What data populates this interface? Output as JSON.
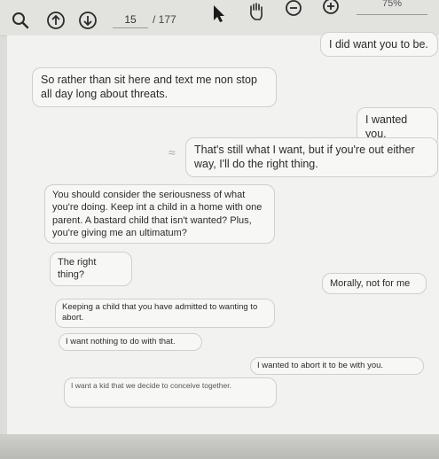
{
  "toolbar": {
    "page_current": "15",
    "page_total": "/ 177",
    "zoom": "75%"
  },
  "messages": [
    {
      "side": "right",
      "text": "I did want you to be."
    },
    {
      "side": "left",
      "text": "So rather than sit here and text me non stop all day long about threats."
    },
    {
      "side": "right",
      "text": "I wanted you."
    },
    {
      "side": "right",
      "text": "That's still what I want, but if you're out either way, I'll do the right thing."
    },
    {
      "side": "left",
      "text": "You should consider the seriousness of what you're doing. Keep int a child in a home with one parent. A bastard child that isn't wanted? Plus, you're giving me an ultimatum?"
    },
    {
      "side": "left",
      "text": "The right thing?"
    },
    {
      "side": "right",
      "text": "Morally, not for me"
    },
    {
      "side": "left",
      "text": "Keeping a child that you have admitted to wanting to abort."
    },
    {
      "side": "left",
      "text": "I want nothing to do with that."
    },
    {
      "side": "right",
      "text": "I wanted to abort it to be with you."
    },
    {
      "side": "left",
      "text": "I want a kid that we decide to conceive together."
    }
  ]
}
